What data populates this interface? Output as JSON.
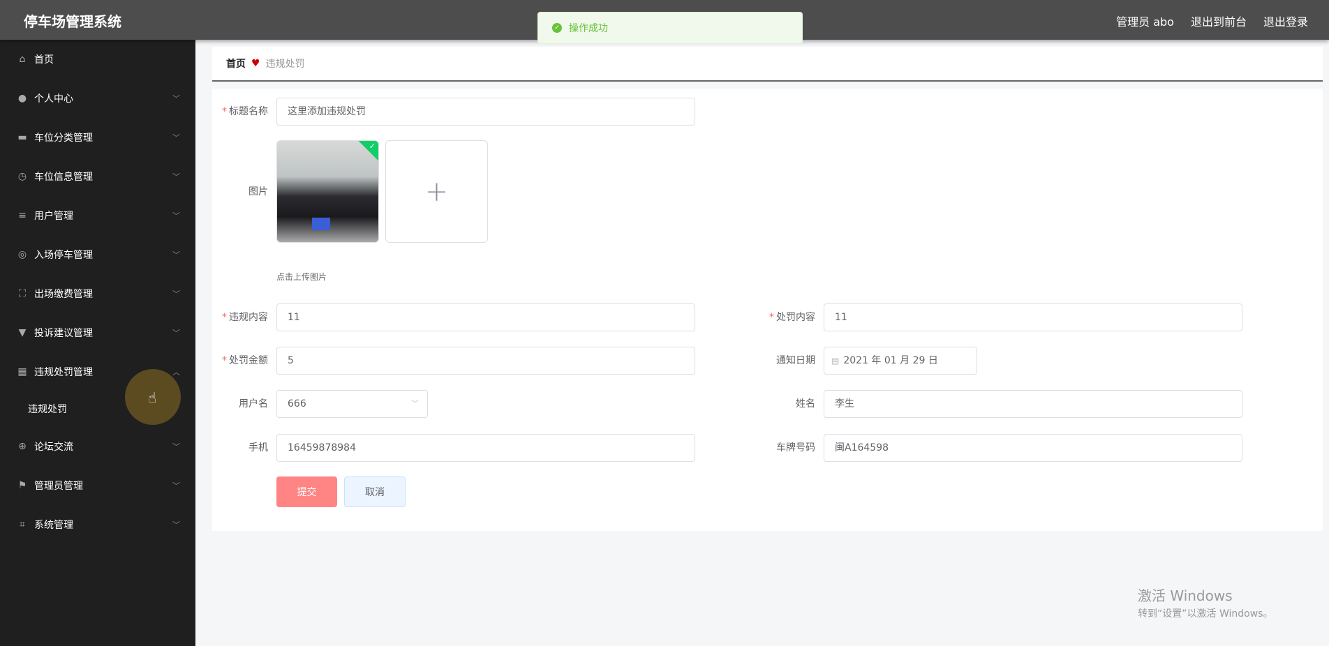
{
  "header": {
    "title": "停车场管理系统",
    "links": [
      "管理员 abo",
      "退出到前台",
      "退出登录"
    ]
  },
  "toast": {
    "message": "操作成功",
    "color": "#67c23a"
  },
  "sidebar": {
    "items": [
      {
        "label": "首页",
        "icon": "home-icon"
      },
      {
        "label": "个人中心",
        "icon": "user-icon"
      },
      {
        "label": "车位分类管理",
        "icon": "monitor-icon"
      },
      {
        "label": "车位信息管理",
        "icon": "compass-icon"
      },
      {
        "label": "用户管理",
        "icon": "list-icon"
      },
      {
        "label": "入场停车管理",
        "icon": "lifebuoy-icon"
      },
      {
        "label": "出场缴费管理",
        "icon": "fullscreen-icon"
      },
      {
        "label": "投诉建议管理",
        "icon": "brush-icon"
      },
      {
        "label": "违规处罚管理",
        "icon": "grid-icon"
      },
      {
        "label": "论坛交流",
        "icon": "crosshair-icon"
      },
      {
        "label": "管理员管理",
        "icon": "flag-icon"
      },
      {
        "label": "系统管理",
        "icon": "crop-icon"
      }
    ],
    "submenu": {
      "label": "违规处罚"
    }
  },
  "breadcrumb": {
    "home": "首页",
    "current": "违规处罚"
  },
  "form": {
    "title": {
      "label": "标题名称",
      "value": "这里添加违规处罚"
    },
    "image": {
      "label": "图片",
      "hint": "点击上传图片"
    },
    "violation": {
      "label": "违规内容",
      "value": "11"
    },
    "penalty": {
      "label": "处罚内容",
      "value": "11"
    },
    "amount": {
      "label": "处罚金额",
      "value": "5"
    },
    "notify_date": {
      "label": "通知日期",
      "value": "2021 年 01 月 29 日"
    },
    "username": {
      "label": "用户名",
      "value": "666"
    },
    "name": {
      "label": "姓名",
      "value": "李生"
    },
    "phone": {
      "label": "手机",
      "value": "16459878984"
    },
    "plate": {
      "label": "车牌号码",
      "value": "闽A164598"
    },
    "submit": "提交",
    "cancel": "取消"
  },
  "watermark": {
    "line1": "激活 Windows",
    "line2": "转到“设置”以激活 Windows。"
  }
}
